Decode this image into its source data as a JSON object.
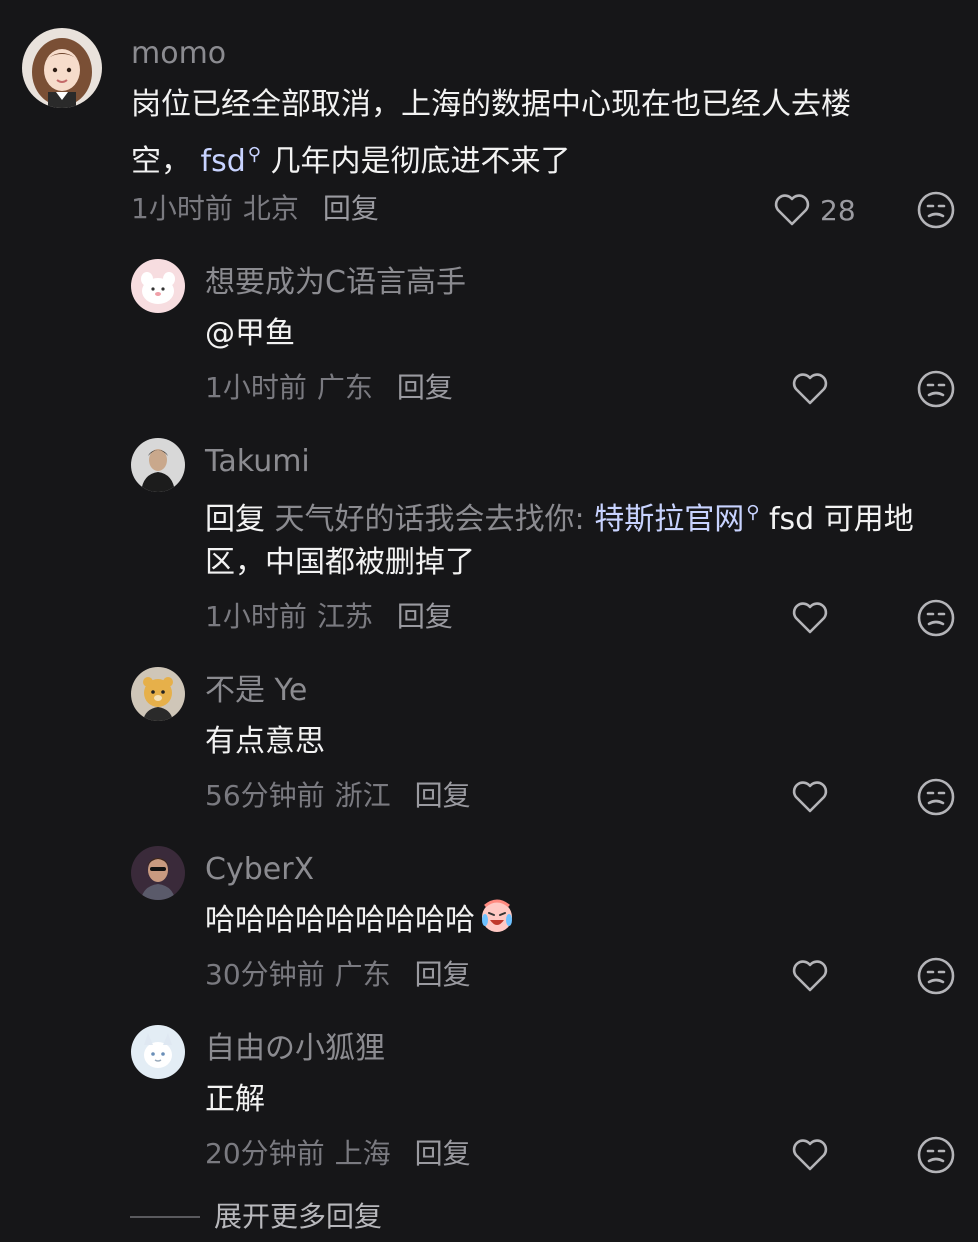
{
  "comments": [
    {
      "username": "momo",
      "text_line1": "岗位已经全部取消，上海的数据中心现在也已经人去楼",
      "text_line2_pre": "空，",
      "link": "fsd",
      "text_line2_post": "几年内是彻底进不来了",
      "time": "1小时前",
      "location": "北京",
      "reply": "回复",
      "likes": "28"
    },
    {
      "username": "想要成为C语言高手",
      "text": "@甲鱼",
      "time": "1小时前",
      "location": "广东",
      "reply": "回复"
    },
    {
      "username": "Takumi",
      "reply_prefix": "回复",
      "quoted_user": "天气好的话我会去找你:",
      "link": "特斯拉官网",
      "text_line1_post": "fsd 可用地",
      "text_line2": "区，中国都被删掉了",
      "time": "1小时前",
      "location": "江苏",
      "reply": "回复"
    },
    {
      "username": "不是 Ye",
      "text": "有点意思",
      "time": "56分钟前",
      "location": "浙江",
      "reply": "回复"
    },
    {
      "username": "CyberX",
      "text": "哈哈哈哈哈哈哈哈哈",
      "time": "30分钟前",
      "location": "广东",
      "reply": "回复"
    },
    {
      "username": "自由の小狐狸",
      "text": "正解",
      "time": "20分钟前",
      "location": "上海",
      "reply": "回复"
    }
  ],
  "expand_label": "展开更多回复",
  "icons": {
    "like": "heart-outline-icon",
    "emoji": "neutral-face-icon",
    "search_mark": "search-icon",
    "laugh": "laughing-crying-emoji"
  },
  "colors": {
    "background": "#161618",
    "text": "#f2f2f2",
    "muted": "#8b8b90",
    "link": "#c8d3ff"
  }
}
